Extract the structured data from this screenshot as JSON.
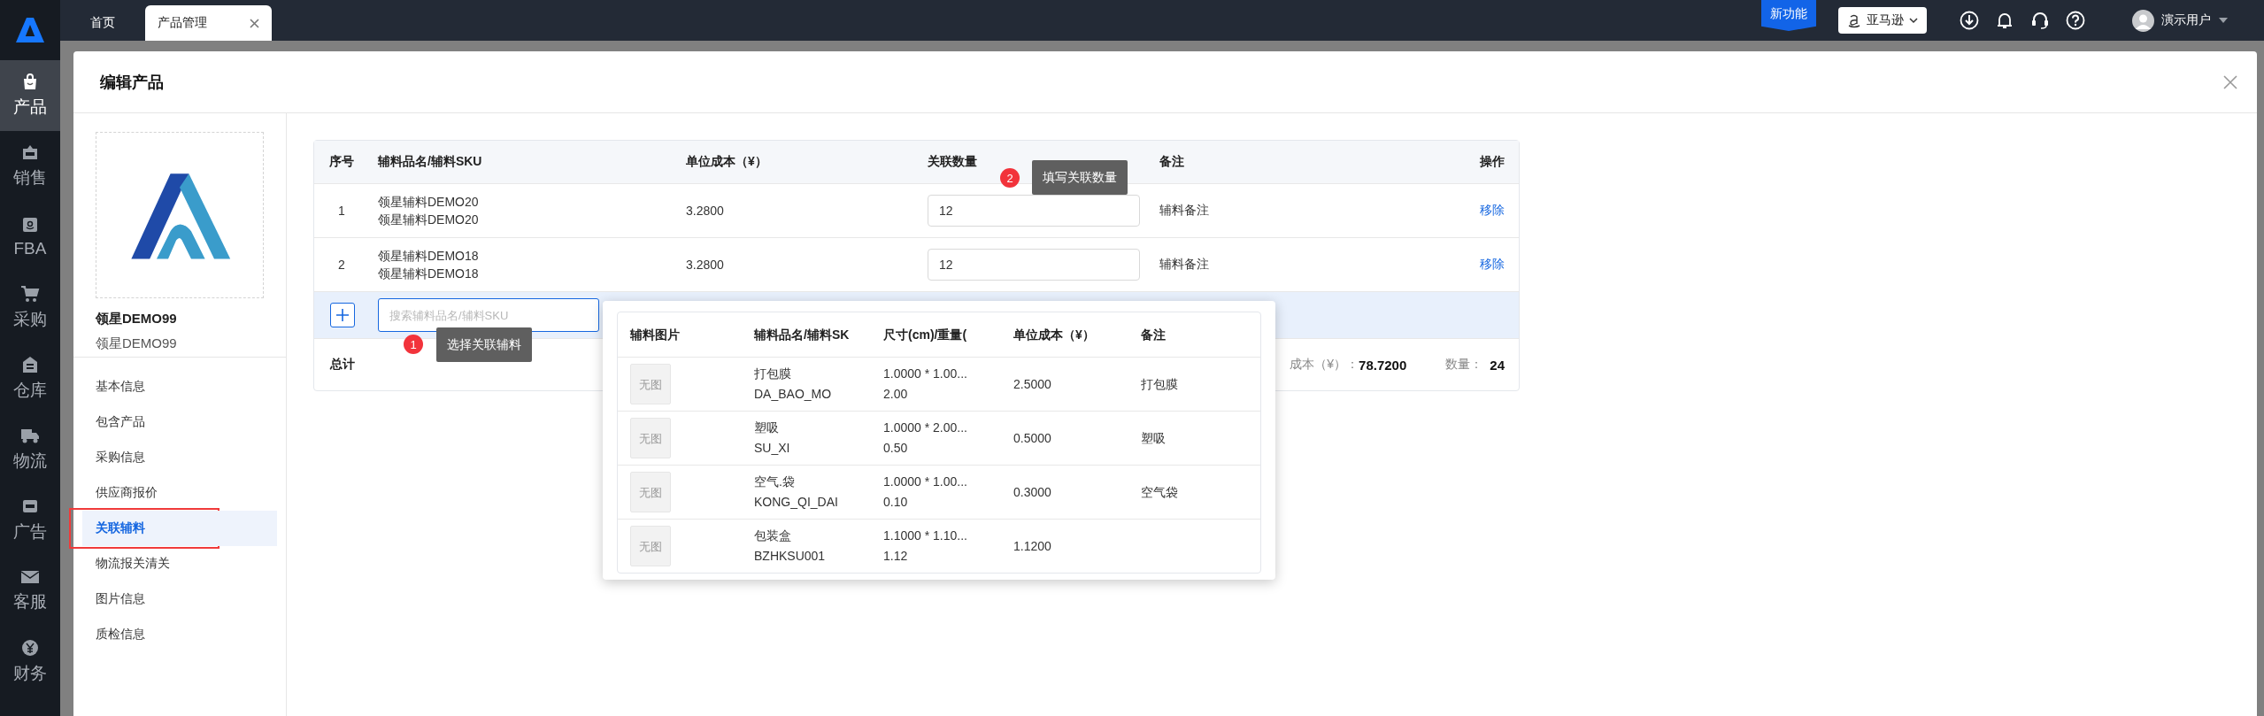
{
  "nav": {
    "items": [
      {
        "label": "产品",
        "selected": true
      },
      {
        "label": "销售",
        "selected": false
      },
      {
        "label": "FBA",
        "selected": false
      },
      {
        "label": "采购",
        "selected": false
      },
      {
        "label": "仓库",
        "selected": false
      },
      {
        "label": "物流",
        "selected": false
      },
      {
        "label": "广告",
        "selected": false
      },
      {
        "label": "客服",
        "selected": false
      },
      {
        "label": "财务",
        "selected": false
      }
    ]
  },
  "topbar": {
    "tabs": [
      {
        "label": "首页",
        "selected": false,
        "closable": false
      },
      {
        "label": "产品管理",
        "selected": true,
        "closable": true
      }
    ],
    "new_feature": "新功能",
    "marketplace": "亚马逊",
    "user": "演示用户"
  },
  "modal": {
    "title": "编辑产品",
    "product": {
      "name": "领星DEMO99",
      "sku": "领星DEMO99"
    },
    "sections": [
      {
        "label": "基本信息",
        "selected": false,
        "highlighted": false
      },
      {
        "label": "包含产品",
        "selected": false,
        "highlighted": false
      },
      {
        "label": "采购信息",
        "selected": false,
        "highlighted": false
      },
      {
        "label": "供应商报价",
        "selected": false,
        "highlighted": false
      },
      {
        "label": "关联辅料",
        "selected": true,
        "highlighted": true
      },
      {
        "label": "物流报关清关",
        "selected": false,
        "highlighted": false
      },
      {
        "label": "图片信息",
        "selected": false,
        "highlighted": false
      },
      {
        "label": "质检信息",
        "selected": false,
        "highlighted": false
      }
    ],
    "table": {
      "columns": [
        "序号",
        "辅料品名/辅料SKU",
        "单位成本（¥）",
        "关联数量",
        "备注",
        "操作"
      ],
      "rows": [
        {
          "index": "1",
          "name": "领星辅料DEMO20",
          "sku": "领星辅料DEMO20",
          "cost": "3.2800",
          "quantity": "12",
          "note": "辅料备注",
          "action": "移除"
        },
        {
          "index": "2",
          "name": "领星辅料DEMO18",
          "sku": "领星辅料DEMO18",
          "cost": "3.2800",
          "quantity": "12",
          "note": "辅料备注",
          "action": "移除"
        }
      ],
      "search": {
        "placeholder": "搜索辅料品名/辅料SKU"
      },
      "total": {
        "label": "总计",
        "cost_label": "成本（¥）：",
        "cost": "78.7200",
        "quantity_label": "数量：",
        "quantity": "24"
      }
    },
    "hints": [
      {
        "number": "1",
        "text": "选择关联辅料"
      },
      {
        "number": "2",
        "text": "填写关联数量"
      }
    ],
    "dropdown": {
      "columns": [
        "辅料图片",
        "辅料品名/辅料SK",
        "尺寸(cm)/重量(",
        "单位成本（¥）",
        "备注"
      ],
      "rows": [
        {
          "image": "无图",
          "name": "打包膜",
          "sku": "DA_BAO_MO",
          "size": "1.0000 * 1.00...",
          "weight": "2.00",
          "cost": "2.5000",
          "note": "打包膜"
        },
        {
          "image": "无图",
          "name": "塑吸",
          "sku": "SU_XI",
          "size": "1.0000 * 2.00...",
          "weight": "0.50",
          "cost": "0.5000",
          "note": "塑吸"
        },
        {
          "image": "无图",
          "name": "空气.袋",
          "sku": "KONG_QI_DAI",
          "size": "1.0000 * 1.00...",
          "weight": "0.10",
          "cost": "0.3000",
          "note": "空气袋"
        },
        {
          "image": "无图",
          "name": "包装盒",
          "sku": "BZHKSU001",
          "size": "1.1000 * 1.10...",
          "weight": "1.12",
          "cost": "1.1200"
        }
      ]
    }
  }
}
